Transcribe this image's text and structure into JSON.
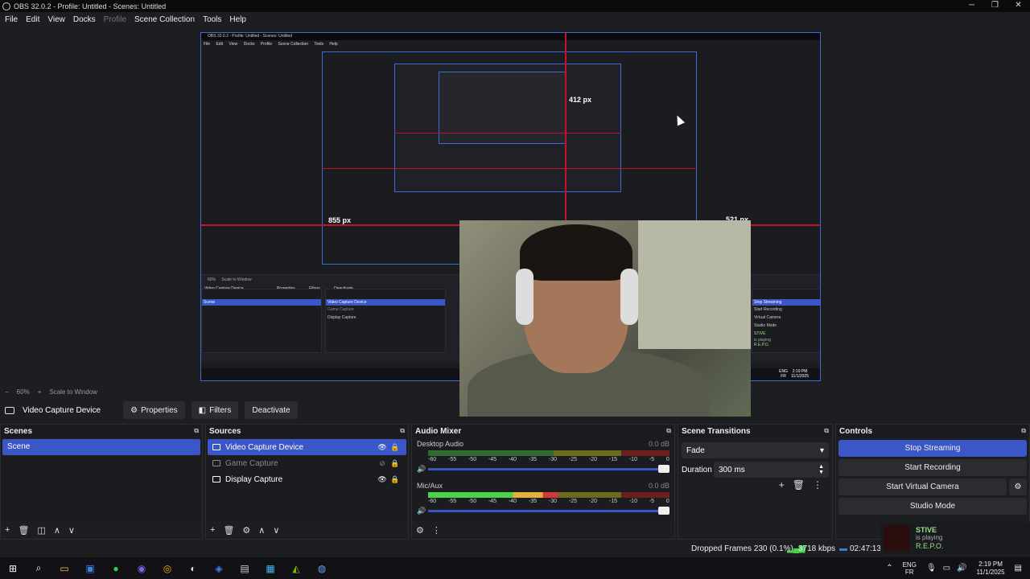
{
  "window": {
    "title": "OBS 32.0.2 - Profile: Untitled - Scenes: Untitled",
    "controls": [
      "─",
      "❐",
      "✕"
    ]
  },
  "menu": [
    "File",
    "Edit",
    "View",
    "Docks",
    "Profile",
    "Scene Collection",
    "Tools",
    "Help"
  ],
  "preview": {
    "mini_title": "OBS 32.0.2 - Profile: Untitled - Scenes: Untitled",
    "mini_menu": [
      "File",
      "Edit",
      "View",
      "Docks",
      "Profile",
      "Scene Collection",
      "Tools",
      "Help"
    ],
    "px_labels": {
      "top": "412 px",
      "left": "855 px",
      "right": "521 px"
    },
    "mini_source": "Video Capture Device",
    "mini_buttons": [
      "Properties",
      "Filters",
      "Deactivate"
    ],
    "mini_scene": "Scene",
    "mini_sources": [
      "Video Capture Device",
      "Game Capture",
      "Display Capture"
    ],
    "mini_controls": [
      "Stop Streaming",
      "Start Recording",
      "Virtual Camera",
      "Studio Mode"
    ],
    "mini_notif": {
      "name": "STIVE",
      "status": "is playing",
      "game": "R.E.P.O."
    },
    "mini_clock": {
      "time": "2:19 PM",
      "date": "11/1/2025"
    },
    "mini_lang": {
      "top": "ENG",
      "bottom": "FR"
    },
    "mini_zoom": "60%",
    "mini_scale": "Scale to Window"
  },
  "zoom": {
    "minus": "−",
    "value": "60%",
    "plus": "+",
    "mode": "Scale to Window"
  },
  "source_toolbar": {
    "source_name": "Video Capture Device",
    "properties": "Properties",
    "filters": "Filters",
    "deactivate": "Deactivate"
  },
  "scenes": {
    "title": "Scenes",
    "items": [
      "Scene"
    ],
    "footer": [
      "+",
      "🗑",
      "◫",
      "∧",
      "∨"
    ]
  },
  "sources": {
    "title": "Sources",
    "items": [
      {
        "label": "Video Capture Device",
        "selected": true,
        "visible": true
      },
      {
        "label": "Game Capture",
        "selected": false,
        "visible": false
      },
      {
        "label": "Display Capture",
        "selected": false,
        "visible": true
      }
    ],
    "footer": [
      "+",
      "🗑",
      "⚙",
      "∧",
      "∨"
    ]
  },
  "audio_mixer": {
    "title": "Audio Mixer",
    "scale": [
      "-60",
      "-55",
      "-50",
      "-45",
      "-40",
      "-35",
      "-30",
      "-25",
      "-20",
      "-15",
      "-10",
      "-5",
      "0"
    ],
    "channels": [
      {
        "name": "Desktop Audio",
        "db": "0.0 dB",
        "level": 0
      },
      {
        "name": "Mic/Aux",
        "db": "0.0 dB",
        "level": 0.54
      }
    ],
    "footer": [
      "⚙",
      "⋮"
    ]
  },
  "transitions": {
    "title": "Scene Transitions",
    "selected": "Fade",
    "duration_label": "Duration",
    "duration_value": "300 ms",
    "actions": [
      "+",
      "🗑",
      "⋮"
    ]
  },
  "controls": {
    "title": "Controls",
    "stop_streaming": "Stop Streaming",
    "start_recording": "Start Recording",
    "start_virtual_camera": "Start Virtual Camera",
    "studio_mode": "Studio Mode"
  },
  "status": {
    "dropped_frames": "Dropped Frames 230 (0.1%)",
    "bitrate": "3718 kbps",
    "stream_time": "02:47:13"
  },
  "notification": {
    "name": "STIVE",
    "status": "is playing",
    "game": "R.E.P.O."
  },
  "taskbar": {
    "icons": [
      "windows-icon",
      "search-icon",
      "file-explorer-icon",
      "store-icon",
      "spotify-icon",
      "discord-icon",
      "chrome-icon",
      "obs-icon",
      "app-icon",
      "app-icon-2",
      "app-icon-3",
      "nvidia-icon",
      "steam-icon"
    ],
    "lang_top": "ENG",
    "lang_bottom": "FR",
    "time": "2:19 PM",
    "date": "11/1/2025"
  },
  "colors": {
    "accent": "#3b56c7",
    "background": "#1d1e22",
    "guide": "#c8102e",
    "meter_green": "#4cd34c",
    "meter_yellow": "#e5b136",
    "meter_red": "#d23a3a"
  }
}
